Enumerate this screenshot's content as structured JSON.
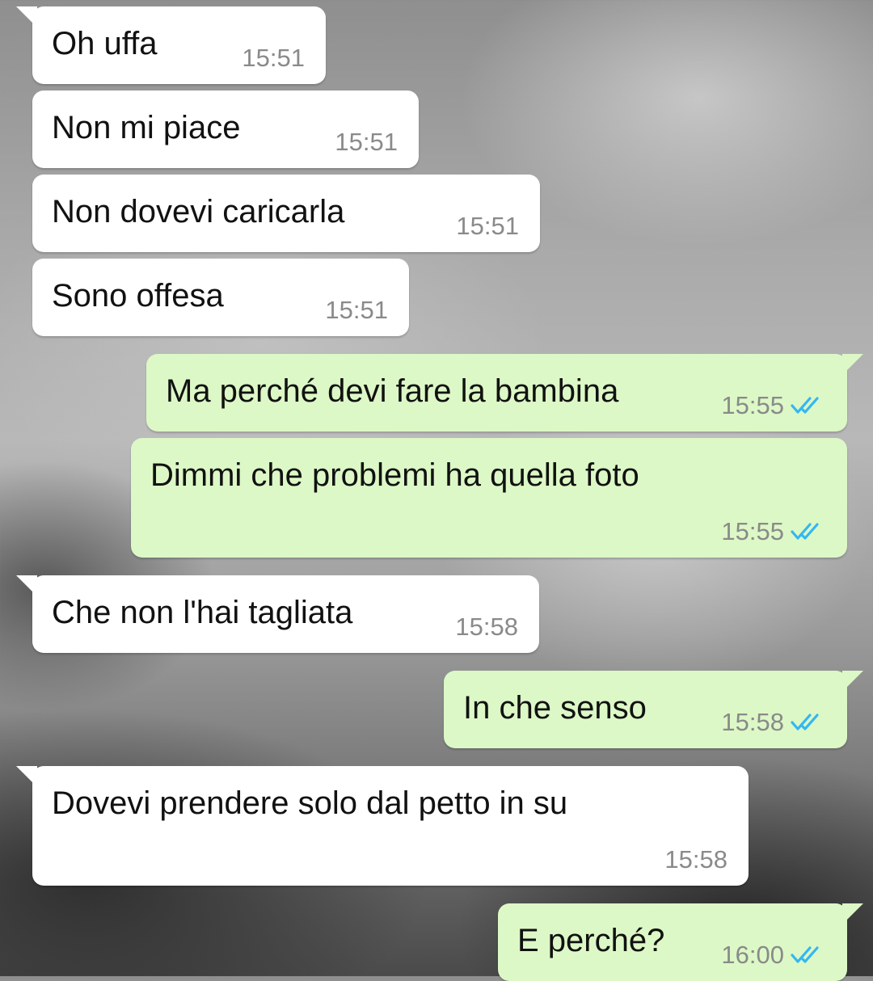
{
  "colors": {
    "incoming_bubble": "#ffffff",
    "outgoing_bubble": "#dcf8c6",
    "read_receipt": "#34b7f1",
    "timestamp": "#8a8a8a"
  },
  "messages": [
    {
      "direction": "incoming",
      "text": "Oh uffa",
      "time": "15:51"
    },
    {
      "direction": "incoming",
      "text": "Non mi piace",
      "time": "15:51"
    },
    {
      "direction": "incoming",
      "text": "Non dovevi caricarla",
      "time": "15:51"
    },
    {
      "direction": "incoming",
      "text": "Sono offesa",
      "time": "15:51"
    },
    {
      "direction": "outgoing",
      "text": "Ma perché devi fare la bambina",
      "time": "15:55",
      "status_icon": "double-check-read-icon"
    },
    {
      "direction": "outgoing",
      "text": "Dimmi che problemi ha quella foto",
      "time": "15:55",
      "status_icon": "double-check-read-icon"
    },
    {
      "direction": "incoming",
      "text": "Che non l'hai tagliata",
      "time": "15:58"
    },
    {
      "direction": "outgoing",
      "text": "In che senso",
      "time": "15:58",
      "status_icon": "double-check-read-icon"
    },
    {
      "direction": "incoming",
      "text": "Dovevi prendere solo dal petto in su",
      "time": "15:58"
    },
    {
      "direction": "outgoing",
      "text": "E perché?",
      "time": "16:00",
      "status_icon": "double-check-read-icon"
    }
  ]
}
